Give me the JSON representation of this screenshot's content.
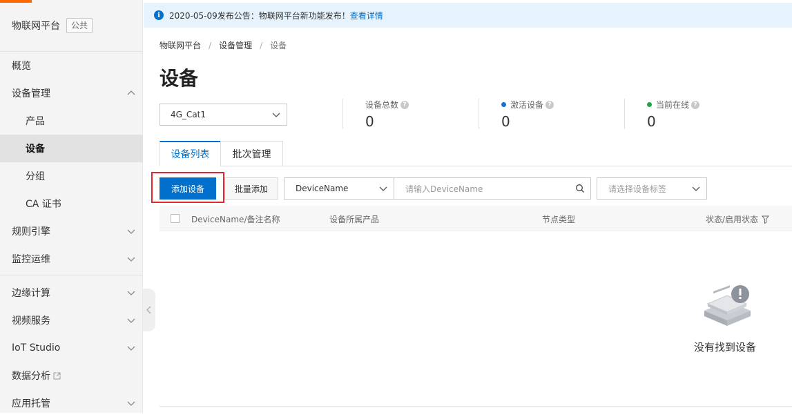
{
  "colors": {
    "accent": "#ff6a00",
    "primary": "#0070cc",
    "highlight_outline": "#e0282e",
    "active_dot": "#1a70c7",
    "online_dot": "#1fa34a"
  },
  "sidebar": {
    "title": "物联网平台",
    "badge": "公共",
    "items": [
      {
        "label": "概览"
      },
      {
        "label": "设备管理",
        "expanded": true
      },
      {
        "label": "产品"
      },
      {
        "label": "设备",
        "active": true
      },
      {
        "label": "分组"
      },
      {
        "label": "CA 证书"
      },
      {
        "label": "规则引擎"
      },
      {
        "label": "监控运维"
      },
      {
        "label": "边缘计算"
      },
      {
        "label": "视频服务"
      },
      {
        "label": "IoT Studio"
      },
      {
        "label": "数据分析"
      },
      {
        "label": "应用托管"
      }
    ]
  },
  "notice": {
    "text": "2020-05-09发布公告：物联网平台新功能发布！",
    "link": "查看详情",
    "icon": "info-icon"
  },
  "breadcrumb": [
    "物联网平台",
    "设备管理",
    "设备"
  ],
  "page_title": "设备",
  "product_select": {
    "value": "4G_Cat1"
  },
  "stats": [
    {
      "label": "设备总数",
      "value": "0"
    },
    {
      "label": "激活设备",
      "value": "0"
    },
    {
      "label": "当前在线",
      "value": "0"
    }
  ],
  "tabs": [
    "设备列表",
    "批次管理"
  ],
  "toolbar": {
    "add_label": "添加设备",
    "batch_label": "批量添加",
    "field_value": "DeviceName",
    "search_placeholder": "请输入DeviceName",
    "tag_placeholder": "请选择设备标签"
  },
  "table": {
    "columns": [
      "DeviceName/备注名称",
      "设备所属产品",
      "节点类型",
      "状态/启用状态"
    ]
  },
  "empty_text": "没有找到设备"
}
